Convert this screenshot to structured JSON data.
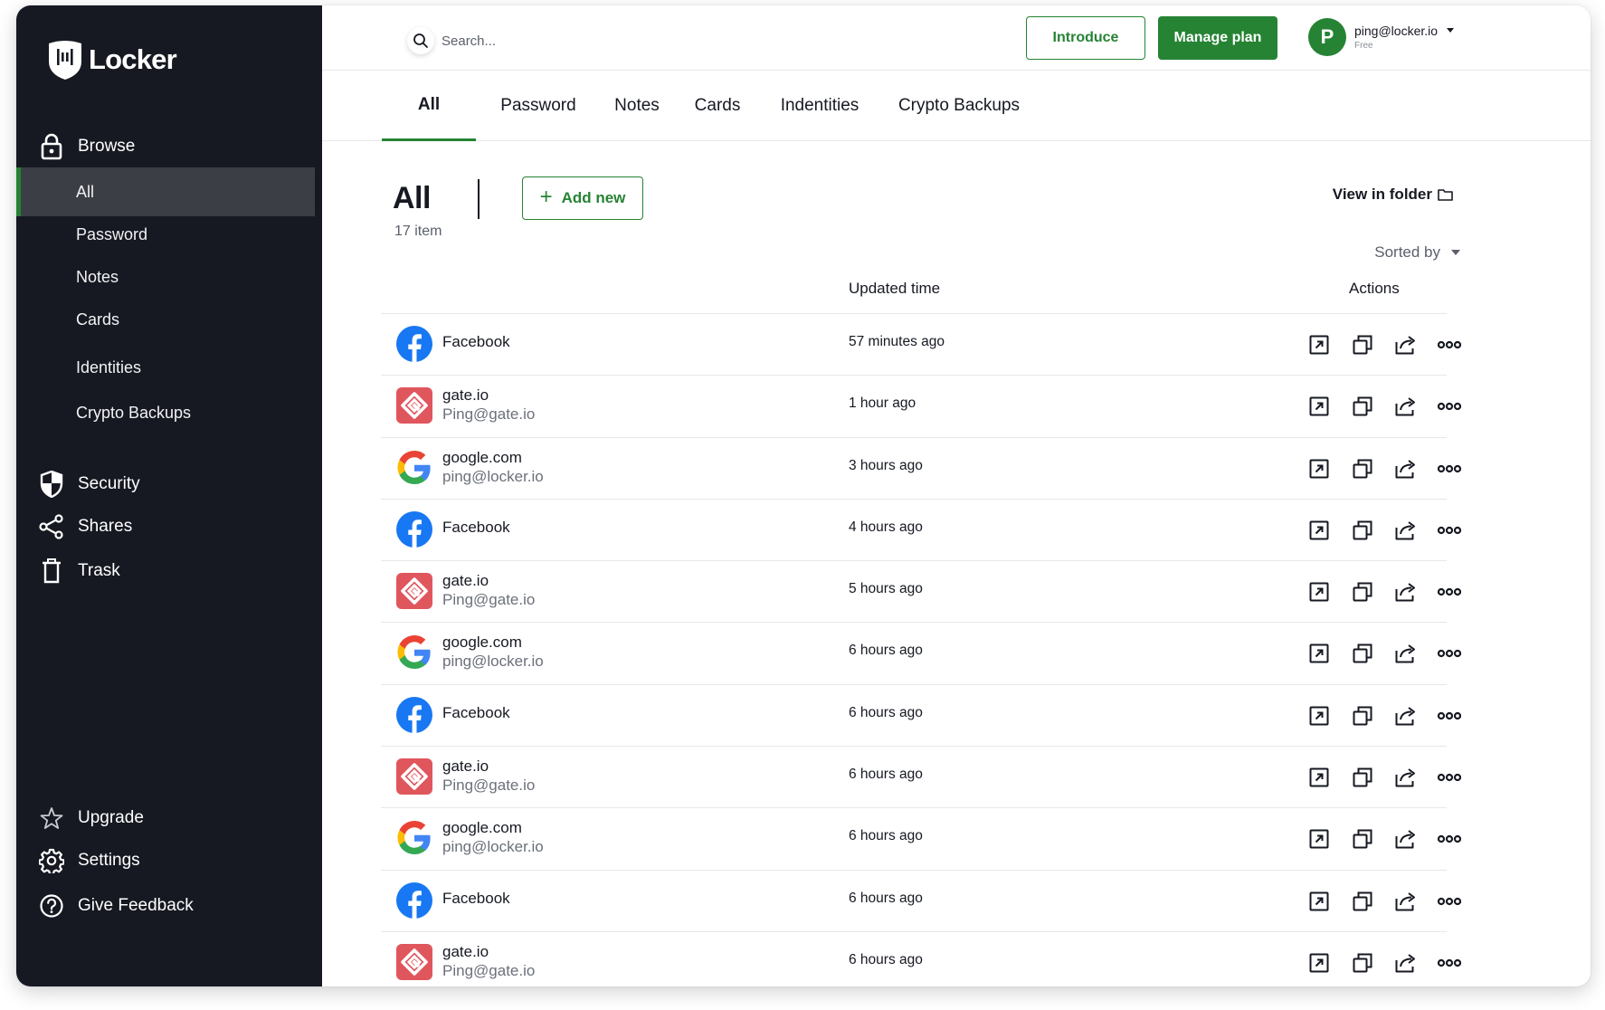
{
  "app": {
    "name": "Locker"
  },
  "sidebar": {
    "browse": "Browse",
    "sub_items": [
      {
        "label": "All",
        "active": true
      },
      {
        "label": "Password"
      },
      {
        "label": "Notes"
      },
      {
        "label": "Cards"
      },
      {
        "label": "Identities"
      },
      {
        "label": "Crypto Backups"
      }
    ],
    "security": "Security",
    "shares": "Shares",
    "trash": "Trask",
    "upgrade": "Upgrade",
    "settings": "Settings",
    "feedback": "Give Feedback"
  },
  "header": {
    "search_placeholder": "Search...",
    "introduce": "Introduce",
    "manage_plan": "Manage plan",
    "avatar_initial": "P",
    "email": "ping@locker.io",
    "plan": "Free"
  },
  "tabs": [
    "All",
    "Password",
    "Notes",
    "Cards",
    "Indentities",
    "Crypto Backups"
  ],
  "content": {
    "title": "All",
    "count": "17 item",
    "add_new": "Add new",
    "view_in_folder": "View in folder",
    "sorted_by": "Sorted by",
    "col_updated": "Updated time",
    "col_actions": "Actions"
  },
  "items": [
    {
      "icon": "facebook",
      "name": "Facebook",
      "sub": "",
      "time": "57 minutes ago"
    },
    {
      "icon": "gate",
      "name": "gate.io",
      "sub": "Ping@gate.io",
      "time": "1 hour ago"
    },
    {
      "icon": "google",
      "name": "google.com",
      "sub": "ping@locker.io",
      "time": "3 hours ago"
    },
    {
      "icon": "facebook",
      "name": "Facebook",
      "sub": "",
      "time": "4 hours ago"
    },
    {
      "icon": "gate",
      "name": "gate.io",
      "sub": "Ping@gate.io",
      "time": "5 hours ago"
    },
    {
      "icon": "google",
      "name": "google.com",
      "sub": "ping@locker.io",
      "time": "6 hours ago"
    },
    {
      "icon": "facebook",
      "name": "Facebook",
      "sub": "",
      "time": "6 hours ago"
    },
    {
      "icon": "gate",
      "name": "gate.io",
      "sub": "Ping@gate.io",
      "time": "6 hours ago"
    },
    {
      "icon": "google",
      "name": "google.com",
      "sub": "ping@locker.io",
      "time": "6 hours ago"
    },
    {
      "icon": "facebook",
      "name": "Facebook",
      "sub": "",
      "time": "6 hours ago"
    },
    {
      "icon": "gate",
      "name": "gate.io",
      "sub": "Ping@gate.io",
      "time": "6 hours ago"
    }
  ],
  "row_actions": [
    "open-external-icon",
    "copy-icon",
    "share-icon",
    "more-icon"
  ],
  "colors": {
    "brand": "#268334",
    "sidebar_bg": "#161922",
    "active_item_bg": "#3b3e45",
    "facebook": "#1877f2",
    "gate": "#e0565d"
  }
}
